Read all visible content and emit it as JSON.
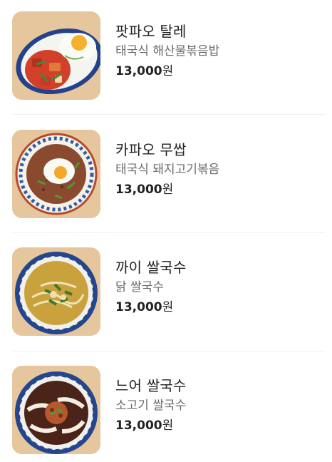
{
  "menu": {
    "items": [
      {
        "name": "팟파오 탈레",
        "description": "태국식 해산물볶음밥",
        "price": "13,000",
        "currency": "원",
        "image_icon": "seafood-fried-rice-photo"
      },
      {
        "name": "카파오 무쌉",
        "description": "태국식 돼지고기볶음",
        "price": "13,000",
        "currency": "원",
        "image_icon": "pork-basil-rice-photo"
      },
      {
        "name": "까이 쌀국수",
        "description": "닭 쌀국수",
        "price": "13,000",
        "currency": "원",
        "image_icon": "chicken-noodle-soup-photo"
      },
      {
        "name": "느어 쌀국수",
        "description": "소고기 쌀국수",
        "price": "13,000",
        "currency": "원",
        "image_icon": "beef-noodle-soup-photo"
      }
    ]
  },
  "colors": {
    "title_text": "#222222",
    "description_text": "#6b6b6b",
    "divider": "#f0f0f0",
    "photo_background": "#e9c9a0"
  }
}
